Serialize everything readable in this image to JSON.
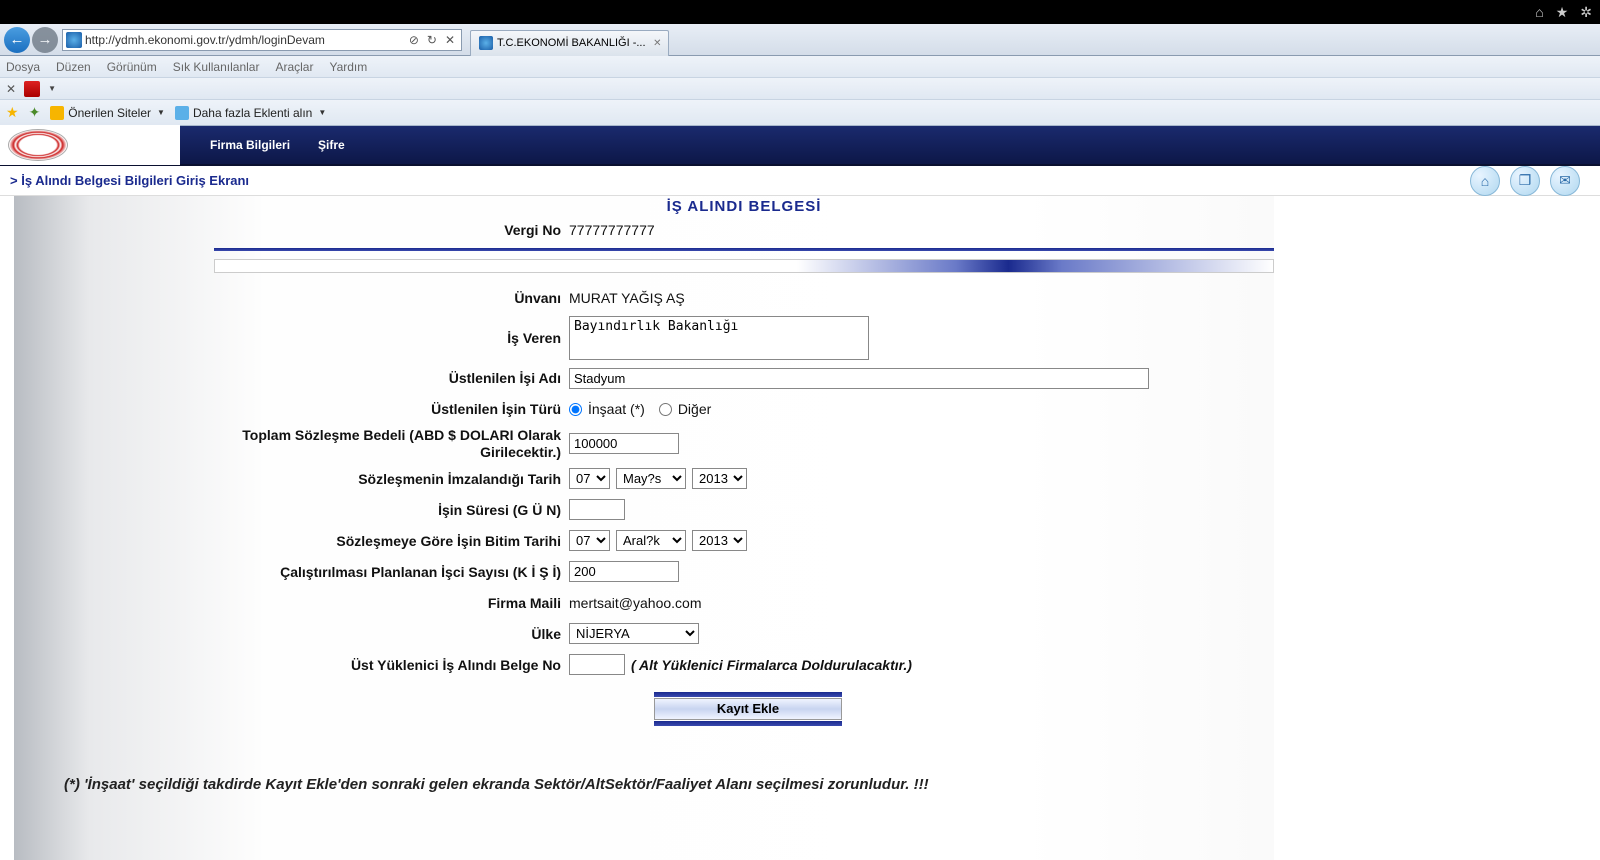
{
  "browser": {
    "url_prefix": "http://",
    "url_host": "ydmh.ekonomi.gov.tr",
    "url_path": "/ydmh/loginDevam",
    "tab_title": "T.C.EKONOMİ BAKANLIĞI -...",
    "menu": {
      "file": "Dosya",
      "edit": "Düzen",
      "view": "Görünüm",
      "favorites": "Sık Kullanılanlar",
      "tools": "Araçlar",
      "help": "Yardım"
    },
    "fav1": "Önerilen Siteler",
    "fav2": "Daha fazla Eklenti alın"
  },
  "app": {
    "menu": {
      "firma": "Firma Bilgileri",
      "sifre": "Şifre"
    },
    "breadcrumb": "İş Alındı Belgesi Bilgileri Giriş Ekranı"
  },
  "form": {
    "title": "İŞ ALINDI BELGESİ",
    "labels": {
      "vergi_no": "Vergi No",
      "unvani": "Ünvanı",
      "is_veren": "İş Veren",
      "ustlenilen_isi_adi": "Üstlenilen İşi Adı",
      "ustlenilen_isin_turu": "Üstlenilen İşin Türü",
      "toplam_bedel": "Toplam Sözleşme Bedeli (ABD $ DOLARI Olarak Girilecektir.)",
      "soz_imza_tarih": "Sözleşmenin İmzalandığı Tarih",
      "is_suresi": "İşin Süresi (G Ü N)",
      "bitim_tarih": "Sözleşmeye Göre İşin Bitim Tarihi",
      "isci_sayisi": "Çalıştırılması Planlanan İşci Sayısı (K İ Ş İ)",
      "firma_maili": "Firma Maili",
      "ulke": "Ülke",
      "ust_yuklenici": "Üst Yüklenici İş Alındı Belge No"
    },
    "values": {
      "vergi_no": "77777777777",
      "unvani": "MURAT YAĞIŞ AŞ",
      "is_veren": "Bayındırlık Bakanlığı",
      "ustlenilen_isi_adi": "Stadyum",
      "tur_insaat": "İnşaat (*)",
      "tur_diger": "Diğer",
      "toplam_bedel": "100000",
      "imza_gun": "07",
      "imza_ay": "May?s",
      "imza_yil": "2013",
      "is_suresi": "",
      "bitim_gun": "07",
      "bitim_ay": "Aral?k",
      "bitim_yil": "2013",
      "isci_sayisi": "200",
      "firma_maili": "mertsait@yahoo.com",
      "ulke": "NİJERYA",
      "ust_yuklenici": "",
      "ust_yuklenici_hint": "( Alt Yüklenici Firmalarca Doldurulacaktır.)"
    },
    "submit": "Kayıt Ekle",
    "footnote": "(*) 'İnşaat' seçildiği takdirde Kayıt Ekle'den sonraki gelen ekranda Sektör/AltSektör/Faaliyet Alanı seçilmesi zorunludur. !!!"
  }
}
